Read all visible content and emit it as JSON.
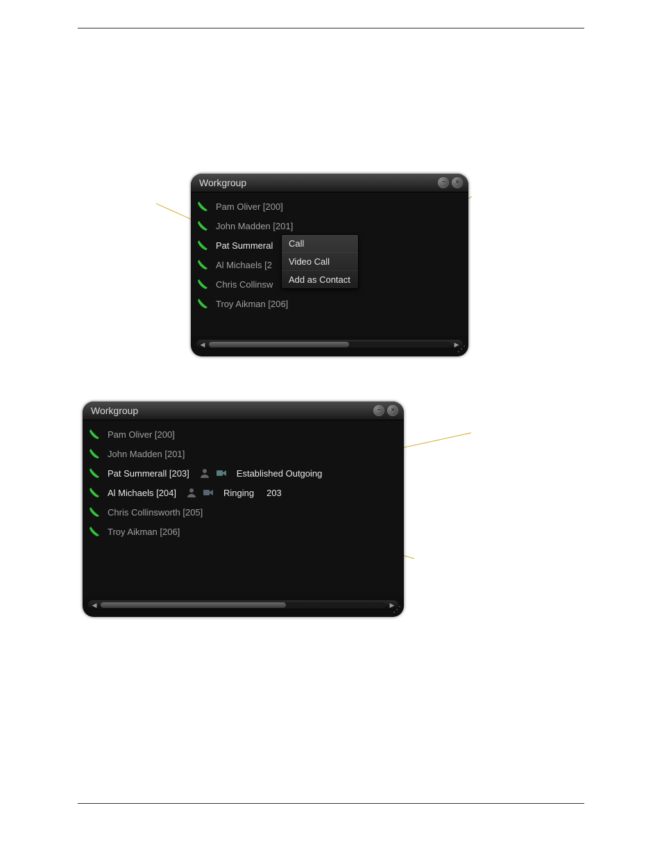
{
  "colors": {
    "accent_green": "#34c23a",
    "callout": "#d8b84a"
  },
  "window1": {
    "title": "Workgroup",
    "rows": [
      {
        "label": "Pam Oliver [200]",
        "active": false
      },
      {
        "label": "John Madden [201]",
        "active": false
      },
      {
        "label": "Pat Summeral",
        "active": true
      },
      {
        "label": "Al Michaels [2",
        "active": false
      },
      {
        "label": "Chris Collinsw",
        "active": false
      },
      {
        "label": "Troy Aikman [206]",
        "active": false
      }
    ],
    "context_menu": {
      "items": [
        {
          "label": "Call"
        },
        {
          "label": "Video Call"
        },
        {
          "label": "Add as Contact"
        }
      ]
    }
  },
  "window2": {
    "title": "Workgroup",
    "rows": [
      {
        "label": "Pam Oliver [200]"
      },
      {
        "label": "John Madden [201]"
      },
      {
        "label": "Pat Summerall [203]",
        "active": true,
        "status": "Established Outgoing"
      },
      {
        "label": "Al Michaels [204]",
        "active": true,
        "status": "Ringing",
        "ext": "203"
      },
      {
        "label": "Chris Collinsworth [205]"
      },
      {
        "label": "Troy Aikman [206]"
      }
    ]
  }
}
